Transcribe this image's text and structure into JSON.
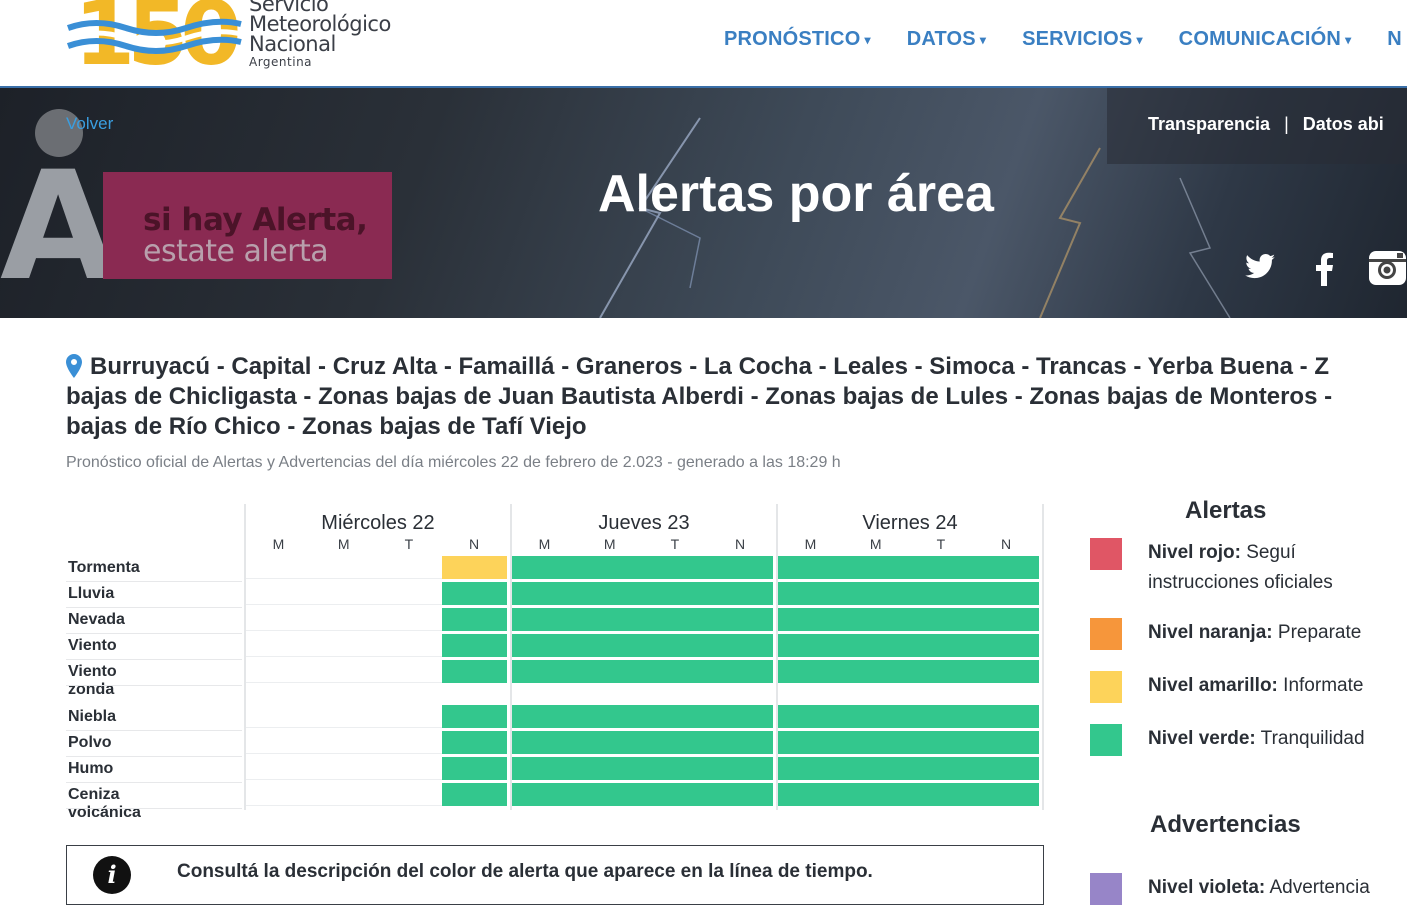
{
  "header": {
    "logo_number": "150",
    "logo_lines": [
      "Servicio",
      "Meteorológico",
      "Nacional"
    ],
    "logo_country": "Argentina",
    "nav": [
      {
        "label": "PRONÓSTICO"
      },
      {
        "label": "DATOS"
      },
      {
        "label": "SERVICIOS"
      },
      {
        "label": "COMUNICACIÓN"
      },
      {
        "label": "N"
      }
    ]
  },
  "banner": {
    "back_link": "Volver",
    "top_links": [
      "Transparencia",
      "|",
      "Datos abi"
    ],
    "title": "Alertas por área",
    "campaign_line1": "si hay Alerta,",
    "campaign_line2": "estate alerta",
    "social_icons": [
      "twitter-icon",
      "facebook-icon",
      "instagram-icon"
    ]
  },
  "area": {
    "line1": "Burruyacú - Capital - Cruz Alta - Famaillá - Graneros - La Cocha - Leales - Simoca - Trancas - Yerba Buena - Z",
    "line2": "bajas de Chicligasta - Zonas bajas de Juan Bautista Alberdi - Zonas bajas de Lules - Zonas bajas de Monteros -",
    "line3": "bajas de Río Chico - Zonas bajas de Tafí Viejo",
    "subtitle": "Pronóstico oficial de Alertas y Advertencias del día miércoles 22 de febrero de 2.023 - generado a las 18:29 h"
  },
  "timeline": {
    "days": [
      "Miércoles 22",
      "Jueves 23",
      "Viernes 24"
    ],
    "slots": [
      "M",
      "M",
      "T",
      "N"
    ],
    "colors": {
      "none": "#ffffff",
      "verde": "#33c78d",
      "amarillo": "#fdd35a"
    },
    "rows": [
      {
        "label": "Tormenta",
        "cells": [
          "none",
          "none",
          "none",
          "amarillo",
          "verde",
          "verde",
          "verde",
          "verde",
          "verde",
          "verde",
          "verde",
          "verde"
        ]
      },
      {
        "label": "Lluvia",
        "cells": [
          "none",
          "none",
          "none",
          "verde",
          "verde",
          "verde",
          "verde",
          "verde",
          "verde",
          "verde",
          "verde",
          "verde"
        ]
      },
      {
        "label": "Nevada",
        "cells": [
          "none",
          "none",
          "none",
          "verde",
          "verde",
          "verde",
          "verde",
          "verde",
          "verde",
          "verde",
          "verde",
          "verde"
        ]
      },
      {
        "label": "Viento",
        "cells": [
          "none",
          "none",
          "none",
          "verde",
          "verde",
          "verde",
          "verde",
          "verde",
          "verde",
          "verde",
          "verde",
          "verde"
        ]
      },
      {
        "label": "Viento zonda",
        "cells": [
          "none",
          "none",
          "none",
          "verde",
          "verde",
          "verde",
          "verde",
          "verde",
          "verde",
          "verde",
          "verde",
          "verde"
        ]
      },
      {
        "label": "Niebla",
        "cells": [
          "none",
          "none",
          "none",
          "verde",
          "verde",
          "verde",
          "verde",
          "verde",
          "verde",
          "verde",
          "verde",
          "verde"
        ]
      },
      {
        "label": "Polvo",
        "cells": [
          "none",
          "none",
          "none",
          "verde",
          "verde",
          "verde",
          "verde",
          "verde",
          "verde",
          "verde",
          "verde",
          "verde"
        ]
      },
      {
        "label": "Humo",
        "cells": [
          "none",
          "none",
          "none",
          "verde",
          "verde",
          "verde",
          "verde",
          "verde",
          "verde",
          "verde",
          "verde",
          "verde"
        ]
      },
      {
        "label": "Ceniza volcánica",
        "cells": [
          "none",
          "none",
          "none",
          "verde",
          "verde",
          "verde",
          "verde",
          "verde",
          "verde",
          "verde",
          "verde",
          "verde"
        ]
      }
    ],
    "info_text": "Consultá la descripción del color de alerta que aparece en la línea de tiempo."
  },
  "legend": {
    "alertas_title": "Alertas",
    "alertas": [
      {
        "level": "Nivel rojo:",
        "desc": "Seguí",
        "desc2": "instrucciones oficiales",
        "color": "#e05665"
      },
      {
        "level": "Nivel naranja:",
        "desc": "Preparate",
        "color": "#f6963b"
      },
      {
        "level": "Nivel amarillo:",
        "desc": "Informate",
        "color": "#fdd35a"
      },
      {
        "level": "Nivel verde:",
        "desc": "Tranquilidad",
        "color": "#33c78d"
      }
    ],
    "advertencias_title": "Advertencias",
    "advertencias": [
      {
        "level": "Nivel violeta:",
        "desc": "Advertencia",
        "color": "#9785c8"
      }
    ]
  }
}
